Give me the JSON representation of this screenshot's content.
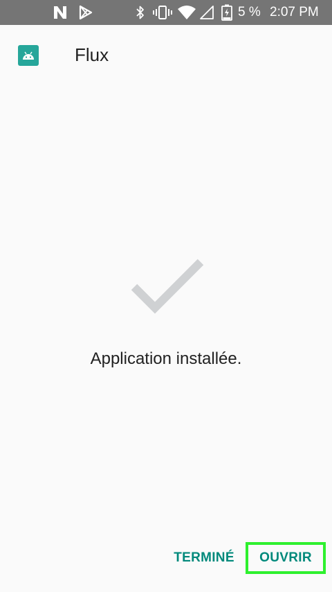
{
  "status_bar": {
    "battery": "5 %",
    "time": "2:07 PM",
    "background": "#757575",
    "icons": [
      "notification-n-icon",
      "play-store-icon",
      "bluetooth-icon",
      "vibrate-icon",
      "wifi-icon",
      "no-signal-icon",
      "battery-charging-icon"
    ]
  },
  "header": {
    "app_icon": "android-robot-icon",
    "title": "Flux",
    "icon_color": "#26a69a"
  },
  "main": {
    "status_icon": "checkmark-icon",
    "message": "Application installée."
  },
  "actions": {
    "done_label": "TERMINÉ",
    "open_label": "OUVRIR",
    "accent": "#00897b",
    "highlight": "#2ef02e"
  }
}
